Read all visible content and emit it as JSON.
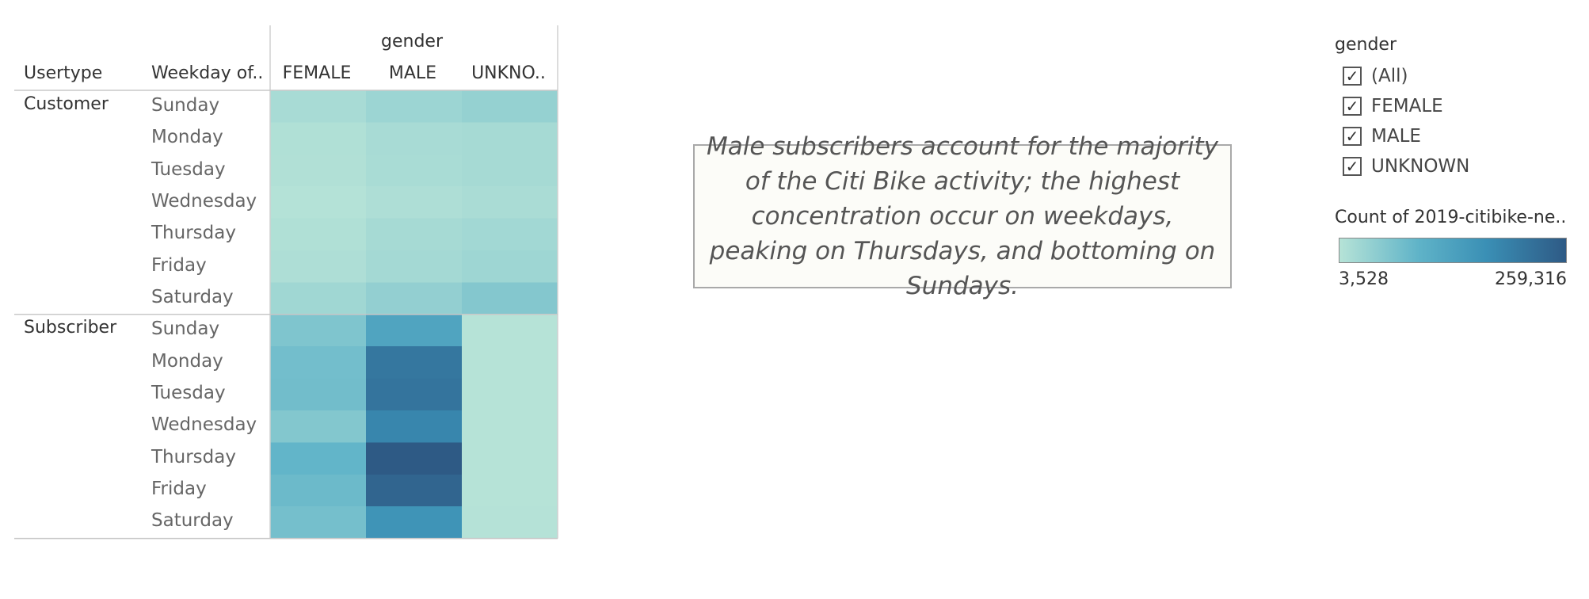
{
  "table": {
    "column_field": "gender",
    "row_headers": [
      "Usertype",
      "Weekday of.."
    ],
    "columns": [
      "FEMALE",
      "MALE",
      "UNKNO.."
    ]
  },
  "note": {
    "text": "Male subscribers account for the majority of the Citi Bike activity; the highest concentration occur on weekdays, peaking on Thursdays, and bottoming on Sundays."
  },
  "filter": {
    "title": "gender",
    "items": [
      {
        "label": "(All)",
        "checked": true
      },
      {
        "label": "FEMALE",
        "checked": true
      },
      {
        "label": "MALE",
        "checked": true
      },
      {
        "label": "UNKNOWN",
        "checked": true
      }
    ]
  },
  "legend": {
    "title": "Count of 2019-citibike-ne..",
    "min_label": "3,528",
    "max_label": "259,316",
    "colors": [
      "#b6e3d7",
      "#5fb3c8",
      "#3a8fb5",
      "#2e5a85"
    ]
  },
  "chart_data": {
    "type": "heatmap",
    "x_field": "gender",
    "x_categories": [
      "FEMALE",
      "MALE",
      "UNKNO.."
    ],
    "color_min": 3528,
    "color_max": 259316,
    "groups": [
      {
        "name": "Customer",
        "rows": [
          {
            "label": "Sunday",
            "values": [
              18000,
              30000,
              38000
            ]
          },
          {
            "label": "Monday",
            "values": [
              10000,
              18000,
              20000
            ]
          },
          {
            "label": "Tuesday",
            "values": [
              9000,
              17000,
              20000
            ]
          },
          {
            "label": "Wednesday",
            "values": [
              6000,
              12000,
              16000
            ]
          },
          {
            "label": "Thursday",
            "values": [
              10000,
              20000,
              24000
            ]
          },
          {
            "label": "Friday",
            "values": [
              12000,
              22000,
              28000
            ]
          },
          {
            "label": "Saturday",
            "values": [
              26000,
              40000,
              55000
            ]
          }
        ]
      },
      {
        "name": "Subscriber",
        "rows": [
          {
            "label": "Sunday",
            "values": [
              60000,
              125000,
              4000
            ]
          },
          {
            "label": "Monday",
            "values": [
              72000,
              210000,
              4000
            ]
          },
          {
            "label": "Tuesday",
            "values": [
              74000,
              215000,
              3800
            ]
          },
          {
            "label": "Wednesday",
            "values": [
              56000,
              185000,
              3600
            ]
          },
          {
            "label": "Thursday",
            "values": [
              90000,
              259316,
              3528
            ]
          },
          {
            "label": "Friday",
            "values": [
              80000,
              240000,
              3600
            ]
          },
          {
            "label": "Saturday",
            "values": [
              70000,
              160000,
              4500
            ]
          }
        ]
      }
    ]
  }
}
